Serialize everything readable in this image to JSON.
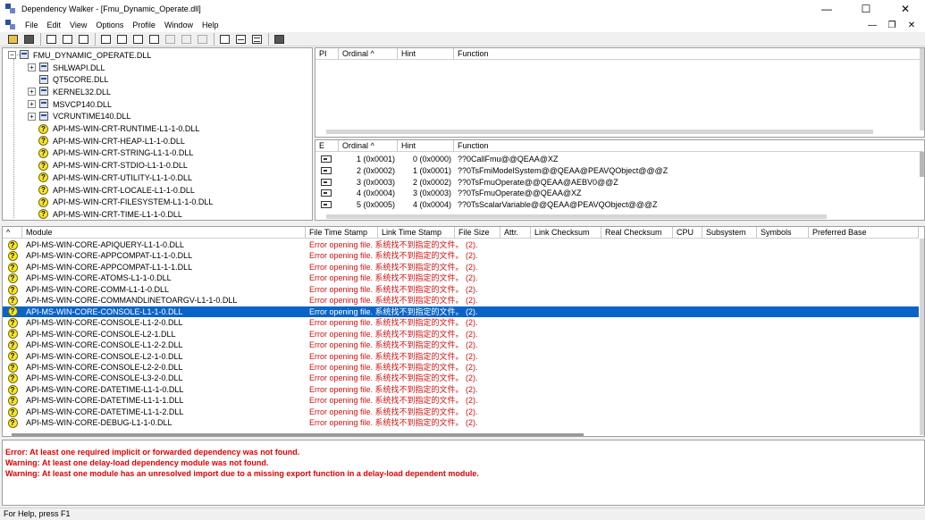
{
  "window": {
    "title": "Dependency Walker - [Fmu_Dynamic_Operate.dll]",
    "minimize": "—",
    "maximize": "☐",
    "close": "✕"
  },
  "menu": {
    "items": [
      "File",
      "Edit",
      "View",
      "Options",
      "Profile",
      "Window",
      "Help"
    ],
    "mdi_minimize": "—",
    "mdi_restore": "❐",
    "mdi_close": "✕"
  },
  "tree": {
    "root": "FMU_DYNAMIC_OPERATE.DLL",
    "children": [
      {
        "label": "SHLWAPI.DLL",
        "icon": "module-icon",
        "expandable": true
      },
      {
        "label": "QT5CORE.DLL",
        "icon": "module-icon",
        "expandable": false
      },
      {
        "label": "KERNEL32.DLL",
        "icon": "module-icon",
        "expandable": true
      },
      {
        "label": "MSVCP140.DLL",
        "icon": "module-icon",
        "expandable": true
      },
      {
        "label": "VCRUNTIME140.DLL",
        "icon": "module-icon",
        "expandable": true
      },
      {
        "label": "API-MS-WIN-CRT-RUNTIME-L1-1-0.DLL",
        "icon": "question-icon",
        "expandable": false
      },
      {
        "label": "API-MS-WIN-CRT-HEAP-L1-1-0.DLL",
        "icon": "question-icon",
        "expandable": false
      },
      {
        "label": "API-MS-WIN-CRT-STRING-L1-1-0.DLL",
        "icon": "question-icon",
        "expandable": false
      },
      {
        "label": "API-MS-WIN-CRT-STDIO-L1-1-0.DLL",
        "icon": "question-icon",
        "expandable": false
      },
      {
        "label": "API-MS-WIN-CRT-UTILITY-L1-1-0.DLL",
        "icon": "question-icon",
        "expandable": false
      },
      {
        "label": "API-MS-WIN-CRT-LOCALE-L1-1-0.DLL",
        "icon": "question-icon",
        "expandable": false
      },
      {
        "label": "API-MS-WIN-CRT-FILESYSTEM-L1-1-0.DLL",
        "icon": "question-icon",
        "expandable": false
      },
      {
        "label": "API-MS-WIN-CRT-TIME-L1-1-0.DLL",
        "icon": "question-icon",
        "expandable": false
      }
    ]
  },
  "parent_functions": {
    "headers": [
      "PI",
      "Ordinal ^",
      "Hint",
      "Function"
    ],
    "rows": []
  },
  "export_functions": {
    "headers": [
      "E",
      "Ordinal ^",
      "Hint",
      "Function"
    ],
    "rows": [
      {
        "ordinal": "1 (0x0001)",
        "hint": "0 (0x0000)",
        "function": "??0CallFmu@@QEAA@XZ"
      },
      {
        "ordinal": "2 (0x0002)",
        "hint": "1 (0x0001)",
        "function": "??0TsFmiModelSystem@@QEAA@PEAVQObject@@@Z"
      },
      {
        "ordinal": "3 (0x0003)",
        "hint": "2 (0x0002)",
        "function": "??0TsFmuOperate@@QEAA@AEBV0@@Z"
      },
      {
        "ordinal": "4 (0x0004)",
        "hint": "3 (0x0003)",
        "function": "??0TsFmuOperate@@QEAA@XZ"
      },
      {
        "ordinal": "5 (0x0005)",
        "hint": "4 (0x0004)",
        "function": "??0TsScalarVariable@@QEAA@PEAVQObject@@@Z"
      }
    ]
  },
  "modules": {
    "headers": [
      "^",
      "Module",
      "File Time Stamp",
      "Link Time Stamp",
      "File Size",
      "Attr.",
      "Link Checksum",
      "Real Checksum",
      "CPU",
      "Subsystem",
      "Symbols",
      "Preferred Base"
    ],
    "error_text": "Error opening file. 系统找不到指定的文件。 (2).",
    "selected_index": 7,
    "rows": [
      "API-MS-WIN-CORE-APIQUERY-L1-1-0.DLL",
      "API-MS-WIN-CORE-APPCOMPAT-L1-1-0.DLL",
      "API-MS-WIN-CORE-APPCOMPAT-L1-1-1.DLL",
      "API-MS-WIN-CORE-ATOMS-L1-1-0.DLL",
      "API-MS-WIN-CORE-COMM-L1-1-0.DLL",
      "API-MS-WIN-CORE-COMMANDLINETOARGV-L1-1-0.DLL",
      "API-MS-WIN-CORE-CONSOLE-L1-1-0.DLL",
      "API-MS-WIN-CORE-CONSOLE-L1-2-0.DLL",
      "API-MS-WIN-CORE-CONSOLE-L2-1.DLL",
      "API-MS-WIN-CORE-CONSOLE-L1-2-2.DLL",
      "API-MS-WIN-CORE-CONSOLE-L2-1-0.DLL",
      "API-MS-WIN-CORE-CONSOLE-L2-2-0.DLL",
      "API-MS-WIN-CORE-CONSOLE-L3-2-0.DLL",
      "API-MS-WIN-CORE-DATETIME-L1-1-0.DLL",
      "API-MS-WIN-CORE-DATETIME-L1-1-1.DLL",
      "API-MS-WIN-CORE-DATETIME-L1-1-2.DLL",
      "API-MS-WIN-CORE-DEBUG-L1-1-0.DLL"
    ]
  },
  "log": [
    "Error: At least one required implicit or forwarded dependency was not found.",
    "Warning: At least one delay-load dependency module was not found.",
    "Warning: At least one module has an unresolved import due to a missing export function in a delay-load dependent module."
  ],
  "status": "For Help, press F1",
  "colors": {
    "selection": "#0a64c8",
    "error_text": "#d01010",
    "log_text": "#e00000",
    "question_icon": "#f7e82a"
  }
}
